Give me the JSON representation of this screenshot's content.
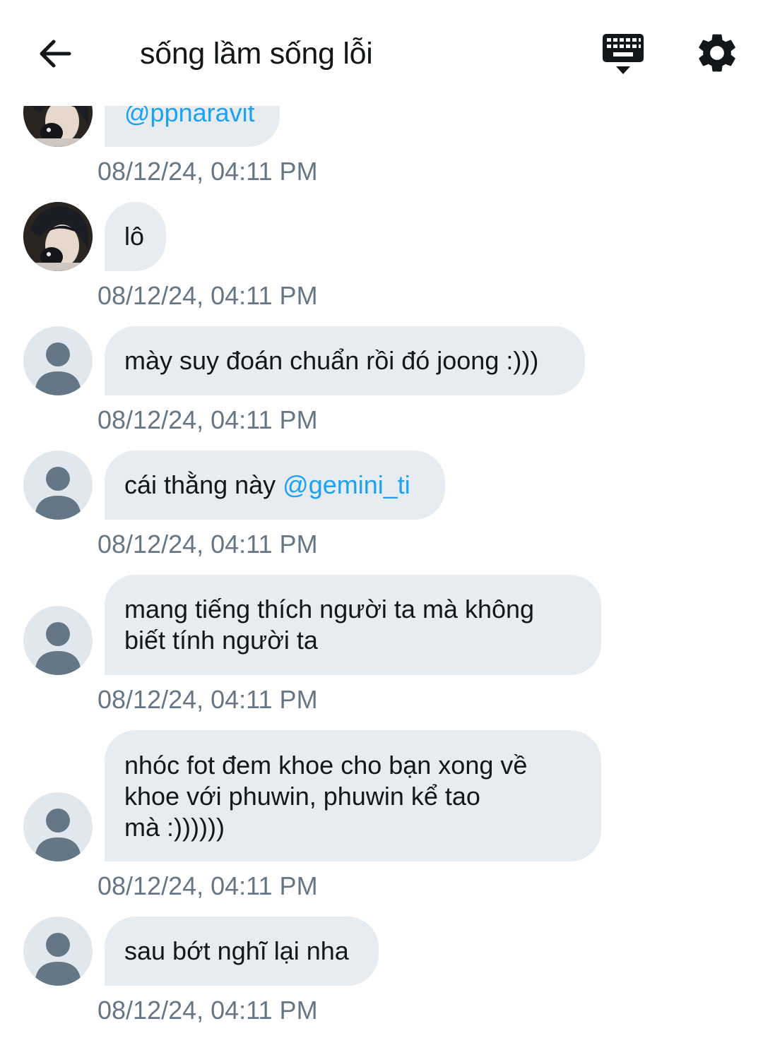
{
  "header": {
    "title": "sống lầm sống lỗi",
    "back_icon": "arrow-left-icon",
    "keyboard_icon": "keyboard-icon",
    "settings_icon": "gear-icon"
  },
  "colors": {
    "bubble_bg": "#e6ecf0",
    "mention": "#1da1f2",
    "timestamp": "#657786",
    "avatar_placeholder": "#e1e8ed"
  },
  "messages": [
    {
      "avatar": "photo",
      "text": "",
      "mention": "@ppnaravit",
      "time": "08/12/24, 04:11 PM"
    },
    {
      "avatar": "photo",
      "text": "lô",
      "mention": "",
      "time": "08/12/24, 04:11 PM"
    },
    {
      "avatar": "default",
      "text": "mày suy đoán chuẩn rồi đó joong :)))",
      "mention": "",
      "time": "08/12/24, 04:11 PM"
    },
    {
      "avatar": "default",
      "text": "cái thằng này ",
      "mention": "@gemini_ti",
      "time": "08/12/24, 04:11 PM"
    },
    {
      "avatar": "default",
      "line1": "mang tiếng thích người ta mà không",
      "line2": "biết tính người ta",
      "time": "08/12/24, 04:11 PM"
    },
    {
      "avatar": "default",
      "line1": "nhóc fot đem khoe cho bạn xong về",
      "line2": "khoe với phuwin, phuwin kể tao",
      "line3": "mà :))))))",
      "time": "08/12/24, 04:11 PM"
    },
    {
      "avatar": "default",
      "text": "sau bớt nghĩ lại nha",
      "mention": "",
      "time": "08/12/24, 04:11 PM"
    }
  ]
}
